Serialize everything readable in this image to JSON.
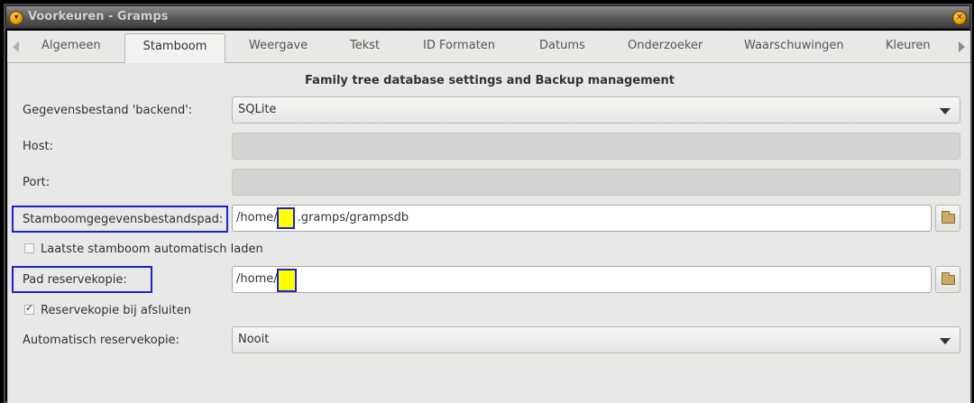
{
  "window": {
    "title": "Voorkeuren - Gramps",
    "min_icon": "▾",
    "close_icon": "✕"
  },
  "tabs": [
    {
      "label": "Algemeen",
      "active": false
    },
    {
      "label": "Stamboom",
      "active": true
    },
    {
      "label": "Weergave",
      "active": false
    },
    {
      "label": "Tekst",
      "active": false
    },
    {
      "label": "ID Formaten",
      "active": false
    },
    {
      "label": "Datums",
      "active": false
    },
    {
      "label": "Onderzoeker",
      "active": false
    },
    {
      "label": "Waarschuwingen",
      "active": false
    },
    {
      "label": "Kleuren",
      "active": false
    }
  ],
  "panel": {
    "heading": "Family tree database settings and Backup management",
    "backend": {
      "label": "Gegevensbestand 'backend':",
      "value": "SQLite"
    },
    "host": {
      "label": "Host:",
      "value": ""
    },
    "port": {
      "label": "Port:",
      "value": ""
    },
    "dbpath": {
      "label": "Stamboomgegevensbestandspad:",
      "value_prefix": "/home/",
      "value_suffix": ".gramps/grampsdb"
    },
    "autoload": {
      "label": "Laatste stamboom automatisch laden",
      "checked": false
    },
    "backup_path": {
      "label": "Pad reservekopie:",
      "value_prefix": "/home/"
    },
    "backup_on_exit": {
      "label": "Reservekopie bij afsluiten",
      "checked": true
    },
    "auto_backup": {
      "label": "Automatisch reservekopie:",
      "value": "Nooit"
    }
  },
  "colors": {
    "annotation_box": "#2020d0",
    "redaction": "#ffff00"
  }
}
